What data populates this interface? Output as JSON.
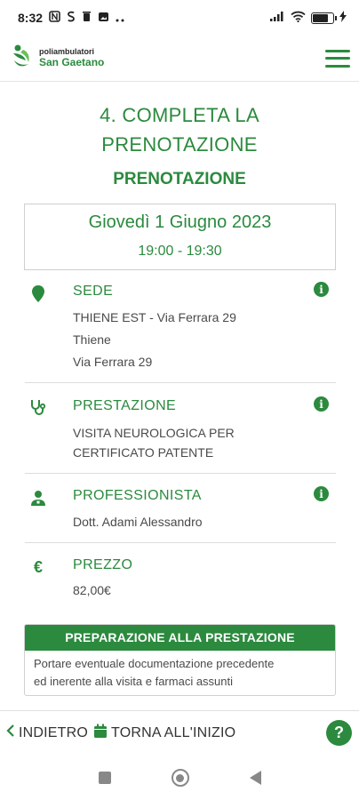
{
  "status_bar": {
    "time": "8:32",
    "icons": [
      "nfc-icon",
      "s-icon",
      "trash-icon",
      "gallery-icon",
      "more-dots-icon"
    ],
    "battery_level": 0.8
  },
  "header": {
    "logo_line1": "poliambulatori",
    "logo_line2": "San Gaetano"
  },
  "page": {
    "step_title_line1": "4. COMPLETA LA",
    "step_title_line2": "PRENOTAZIONE",
    "section_title": "PRENOTAZIONE"
  },
  "appointment": {
    "date": "Giovedì 1 Giugno 2023",
    "time": "19:00 - 19:30"
  },
  "sede": {
    "title": "SEDE",
    "lines": [
      "THIENE EST - Via Ferrara 29",
      "Thiene",
      "Via Ferrara 29"
    ]
  },
  "prestazione": {
    "title": "PRESTAZIONE",
    "lines": [
      "VISITA NEUROLOGICA PER",
      "CERTIFICATO PATENTE"
    ]
  },
  "professionista": {
    "title": "PROFESSIONISTA",
    "lines": [
      "Dott. Adami Alessandro"
    ]
  },
  "prezzo": {
    "title": "PREZZO",
    "value": "82,00€",
    "symbol": "€"
  },
  "preparazione": {
    "title": "PREPARAZIONE ALLA PRESTAZIONE",
    "lines": [
      "Portare eventuale documentazione precedente",
      "ed inerente alla visita e farmaci assunti"
    ]
  },
  "bottom_nav": {
    "back_label": "INDIETRO",
    "home_label": "TORNA ALL'INIZIO",
    "help_label": "?"
  },
  "info_label": "i",
  "colors": {
    "brand_green": "#2b8a3e"
  }
}
